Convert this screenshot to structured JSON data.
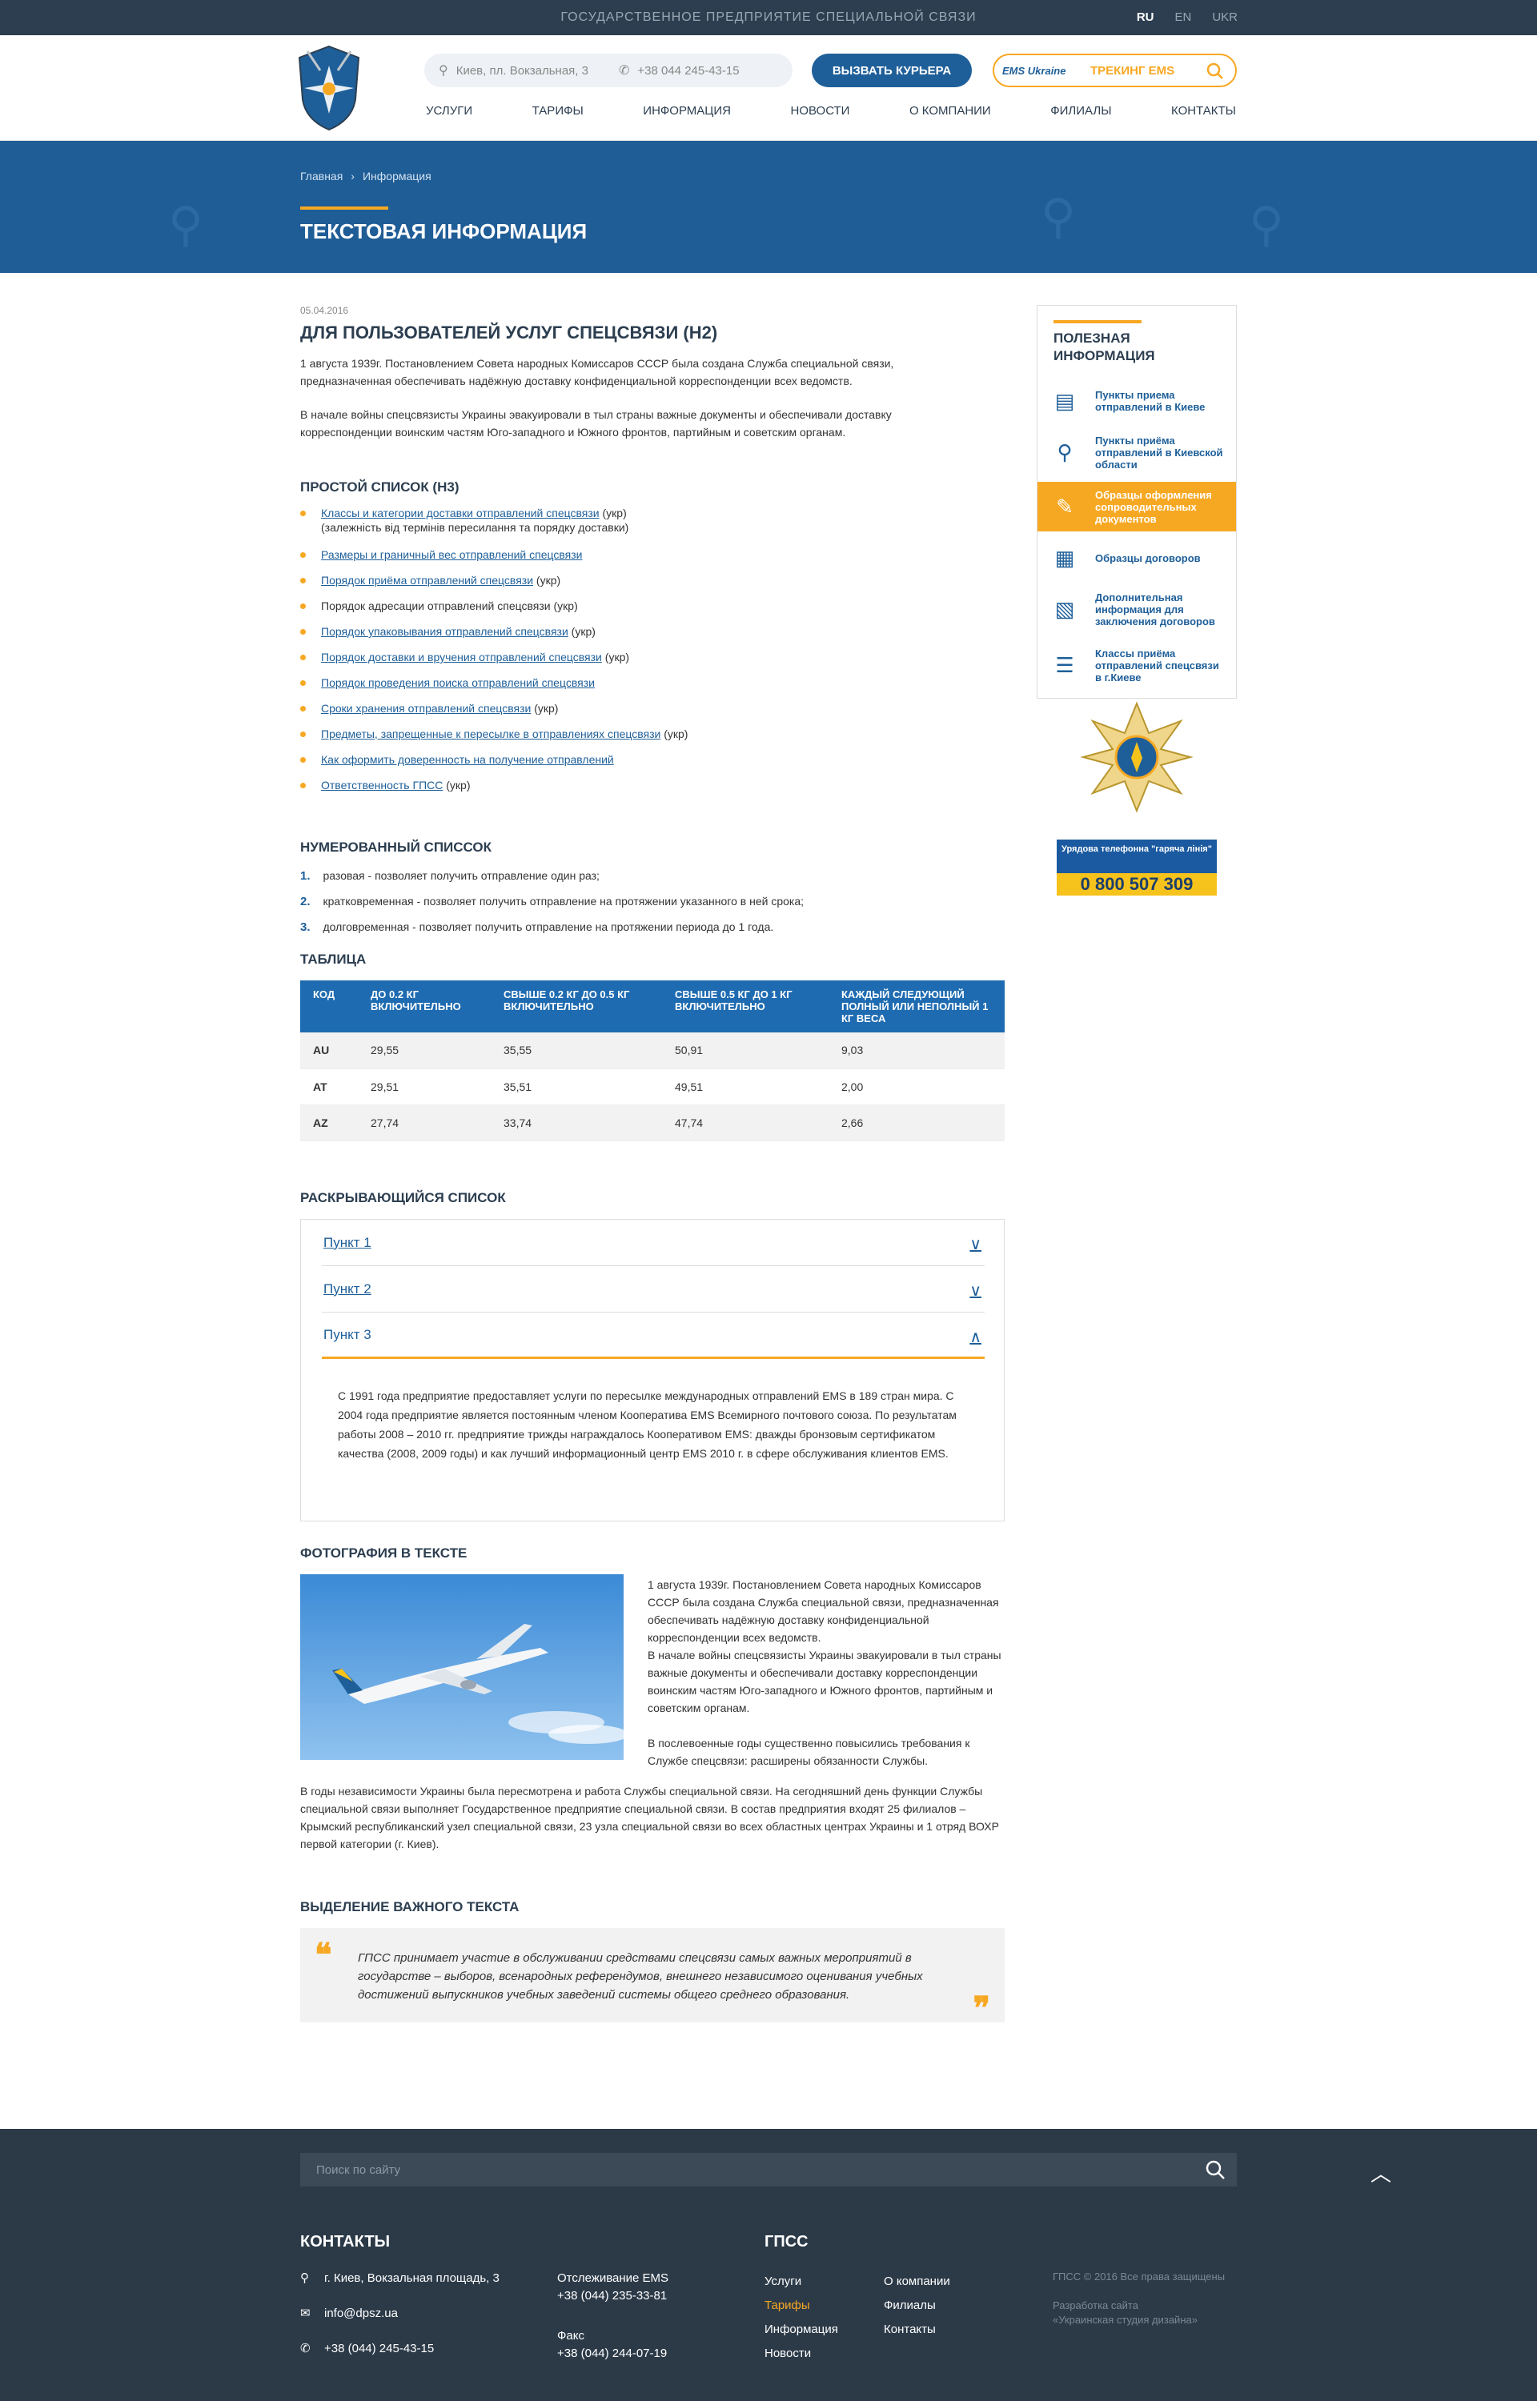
{
  "topbar": {
    "org": "Государственное предприятие специальной связи",
    "langs": [
      "RU",
      "EN",
      "UKR"
    ]
  },
  "header": {
    "address": "Киев, пл. Вокзальная, 3",
    "phone": "+38 044 245-43-15",
    "courier_button": "Вызвать курьера",
    "ems_tracking": "Трекинг EMS",
    "ems_logo": "EMS Ukraine",
    "nav": [
      "Услуги",
      "Тарифы",
      "Информация",
      "Новости",
      "О компании",
      "Филиалы",
      "Контакты"
    ]
  },
  "hero": {
    "breadcrumb": [
      "Главная",
      "Информация"
    ],
    "title": "Текстовая информация"
  },
  "article": {
    "date": "05.04.2016",
    "h2": "Для пользователей услуг спецсвязи (H2)",
    "p1": "1 августа 1939г. Постановлением Совета народных Комиссаров СССР была создана Служба специальной связи, предназначенная обеспечивать надёжную доставку конфиденциальной корреспонденции всех ведомств.",
    "p2": "В начале войны спецсвязисты Украины эвакуировали в тыл страны важные документы и обеспечивали доставку корреспонденции воинским частям Юго-западного и Южного фронтов, партийным и советским органам.",
    "h3_list": "Простой список (H3)",
    "bullets": [
      {
        "link": "Классы и категории доставки отправлений спецсвязи",
        "suffix": " (укр)",
        "note": "(залежність від термінів пересилання та порядку доставки)"
      },
      {
        "link": "Размеры и граничный вес отправлений спецсвязи",
        "suffix": ""
      },
      {
        "link": "Порядок приёма отправлений спецсвязи",
        "suffix": " (укр)"
      },
      {
        "link": "",
        "plain": "Порядок адресации отправлений спецсвязи",
        "suffix": " (укр)"
      },
      {
        "link": "Порядок упаковывания отправлений спецсвязи",
        "suffix": " (укр)"
      },
      {
        "link": "Порядок доставки и вручения отправлений спецсвязи",
        "suffix": " (укр)"
      },
      {
        "link": "Порядок проведения поиска отправлений спецсвязи",
        "suffix": ""
      },
      {
        "link": "Сроки хранения отправлений спецсвязи",
        "suffix": " (укр)"
      },
      {
        "link": "Предметы, запрещенные к пересылке в отправлениях спецсвязи",
        "suffix": " (укр)"
      },
      {
        "link": "Как оформить доверенность на получение отправлений",
        "suffix": ""
      },
      {
        "link": "Ответственность ГПСС",
        "suffix": " (укр)"
      }
    ],
    "h3_numbered": "Нумерованный списсок",
    "numbered": [
      "разовая - позволяет получить отправление один раз;",
      "кратковременная - позволяет получить отправление на протяжении указанного в ней срока;",
      "долговременная - позволяет получить отправление на протяжении  периода до 1 года."
    ],
    "h3_table": "Таблица",
    "table": {
      "headers": [
        "Код",
        "До 0.2 кг включительно",
        "Свыше 0.2 кг до 0.5 кг включительно",
        "Свыше 0.5 кг до 1 кг включительно",
        "Каждый следующий полный или неполный 1 кг веса"
      ],
      "rows": [
        [
          "AU",
          "29,55",
          "35,55",
          "50,91",
          "9,03"
        ],
        [
          "AT",
          "29,51",
          "35,51",
          "49,51",
          "2,00"
        ],
        [
          "AZ",
          "27,74",
          "33,74",
          "47,74",
          "2,66"
        ]
      ]
    },
    "h3_accordion": "Раскрывающийся список",
    "accordion": [
      "Пункт 1",
      "Пункт 2",
      "Пункт 3"
    ],
    "accordion_body": "С 1991 года предприятие предоставляет услуги по пересылке международных отправлений EMS в 189 стран мира. С 2004 года предприятие является постоянным членом Кооператива EMS Всемирного почтового союза. По результатам работы 2008 – 2010 гг. предприятие трижды награждалось Кооперативом EMS: дважды бронзовым сертификатом качества (2008, 2009 годы) и как лучший информационный центр EMS 2010 г. в сфере обслуживания клиентов EMS.",
    "h3_photo": "Фотография в тексте",
    "photo_text1": "1 августа 1939г. Постановлением Совета народных Комиссаров СССР была создана Служба специальной связи, предназначенная обеспечивать надёжную доставку конфиденциальной корреспонденции всех ведомств.",
    "photo_text2": "В начале войны спецсвязисты Украины эвакуировали в тыл страны важные документы и обеспечивали доставку корреспонденции воинским частям Юго-западного и Южного фронтов, партийным и советским органам.",
    "photo_text3": "В послевоенные годы существенно повысились требования к Службе спецсвязи: расширены обязанности Службы.",
    "after_photo": "В годы независимости Украины была пересмотрена и работа Службы специальной связи. На сегодняшний день функции Службы специальной связи выполняет Государственное предприятие специальной связи. В состав предприятия входят 25 филиалов – Крымский республиканский узел специальной связи, 23 узла специальной связи во всех областных центрах Украины и 1 отряд ВОХР первой категории (г. Киев).",
    "h3_quote": "Выделение важного текста",
    "quote": "ГПСС принимает участие в обслуживании средствами спецсвязи самых важных мероприятий в государстве – выборов, всенародных референдумов, внешнего независимого оценивания учебных достижений выпускников учебных заведений системы общего среднего образования."
  },
  "sidebar": {
    "title": "Полезная информация",
    "items": [
      {
        "label": "Пункты приема отправлений в Киеве",
        "icon": "package-icon"
      },
      {
        "label": "Пункты приёма отправлений в Киевской области",
        "icon": "map-pin-icon"
      },
      {
        "label": "Образцы оформления сопроводительных документов",
        "icon": "pencil-icon"
      },
      {
        "label": "Образцы договоров",
        "icon": "document-icon"
      },
      {
        "label": "Дополнительная информация для заключения договоров",
        "icon": "document-search-icon"
      },
      {
        "label": "Классы приёма отправлений спецсвязи в г.Киеве",
        "icon": "list-icon"
      }
    ],
    "hotline_title": "Урядова телефонна \"гаряча лінія\"",
    "hotline_number": "0 800 507 309"
  },
  "footer": {
    "search_placeholder": "Поиск по сайту",
    "contacts_title": "Контакты",
    "address": "г. Киев, Вокзальная площадь, 3",
    "email": "info@dpsz.ua",
    "phone": "+38 (044) 245-43-15",
    "ems_label": "Отслеживание EMS",
    "ems_phone": "+38 (044) 235-33-81",
    "fax_label": "Факс",
    "fax_phone": "+38 (044) 244-07-19",
    "gpss_title": "ГПСС",
    "links_col1": [
      "Услуги",
      "Тарифы",
      "Информация",
      "Новости"
    ],
    "links_col2": [
      "О компании",
      "Филиалы",
      "Контакты"
    ],
    "copyright": "ГПСС © 2016 Все права защищены",
    "dev_label": "Разработка сайта",
    "dev_name": "«Украинская студия дизайна»"
  },
  "colors": {
    "brand_blue": "#1e5f99",
    "accent_orange": "#f7a823",
    "dark": "#2c3e50"
  }
}
